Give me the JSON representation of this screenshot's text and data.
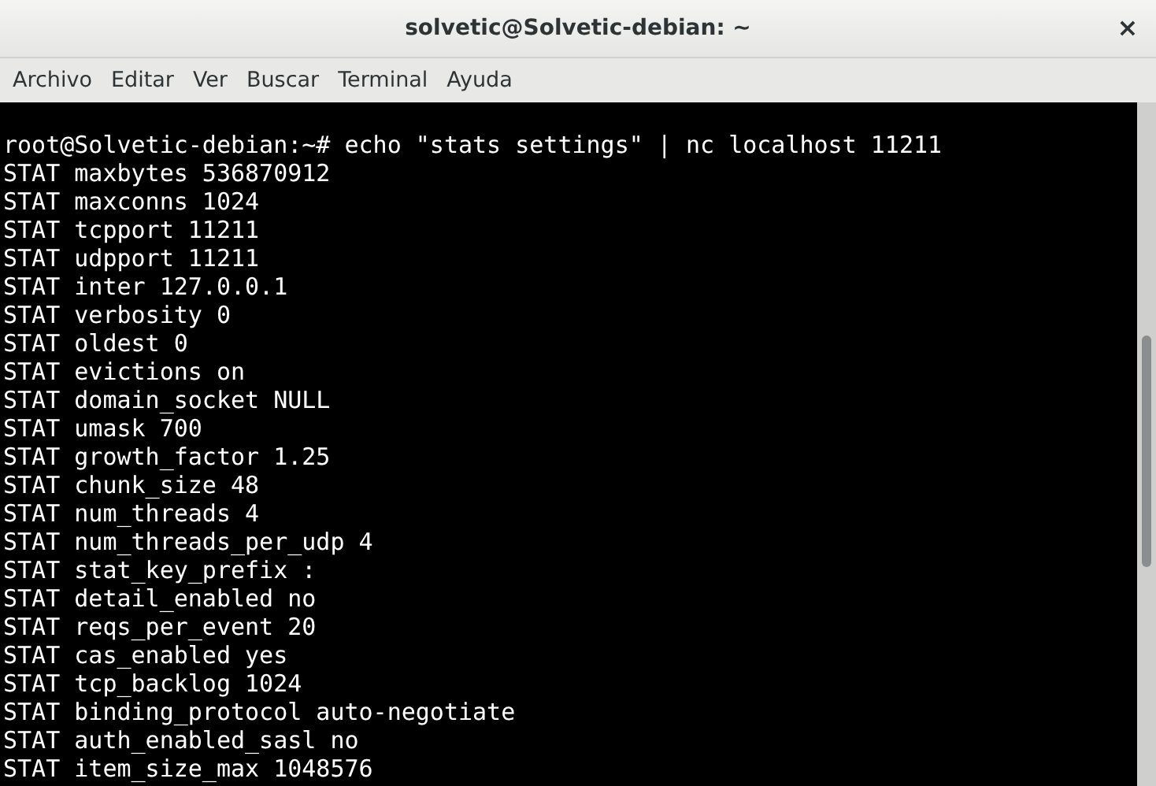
{
  "window": {
    "title": "solvetic@Solvetic-debian: ~",
    "close": "×"
  },
  "menu": [
    "Archivo",
    "Editar",
    "Ver",
    "Buscar",
    "Terminal",
    "Ayuda"
  ],
  "terminal": {
    "lines": [
      "root@Solvetic-debian:~# echo \"stats settings\" | nc localhost 11211",
      "STAT maxbytes 536870912",
      "STAT maxconns 1024",
      "STAT tcpport 11211",
      "STAT udpport 11211",
      "STAT inter 127.0.0.1",
      "STAT verbosity 0",
      "STAT oldest 0",
      "STAT evictions on",
      "STAT domain_socket NULL",
      "STAT umask 700",
      "STAT growth_factor 1.25",
      "STAT chunk_size 48",
      "STAT num_threads 4",
      "STAT num_threads_per_udp 4",
      "STAT stat_key_prefix :",
      "STAT detail_enabled no",
      "STAT reqs_per_event 20",
      "STAT cas_enabled yes",
      "STAT tcp_backlog 1024",
      "STAT binding_protocol auto-negotiate",
      "STAT auth_enabled_sasl no",
      "STAT item_size_max 1048576"
    ]
  }
}
